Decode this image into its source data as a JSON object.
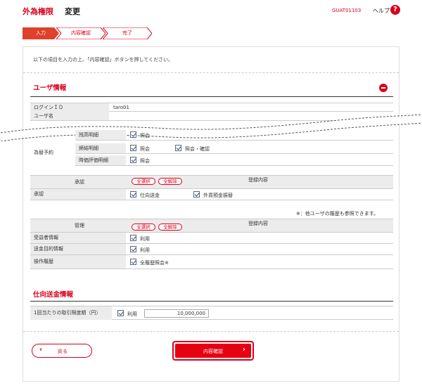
{
  "header": {
    "title_main": "外為権限",
    "title_sub": "変更",
    "screen_code": "GUAT01103",
    "help_label": "ヘルプ",
    "help_icon": "?"
  },
  "steps": [
    {
      "label": "入力",
      "active": true
    },
    {
      "label": "内容確認",
      "active": false
    },
    {
      "label": "完了",
      "active": false
    }
  ],
  "intro": "以下の項目を入力の上、「内容確認」ボタンを押してください。",
  "user_info": {
    "title": "ユーザ情報",
    "login_id_label": "ログインＩＤ",
    "login_id_value": "taro01",
    "user_name_label": "ユーザ名",
    "exchange_label": "為替予約",
    "rows": [
      {
        "label": "残高明細",
        "opt1": "照会"
      },
      {
        "label": "締結明細",
        "opt1": "照会",
        "opt2": "照会・確認"
      },
      {
        "label": "時価評価明細",
        "opt1": "照会"
      }
    ]
  },
  "approval": {
    "col1": "承認",
    "col2": "登録内容",
    "select_all": "全選択",
    "clear_all": "全解除",
    "row_label": "承認",
    "opt1": "仕向送金",
    "opt2": "外貨預金振替"
  },
  "note": "※：他ユーザの履歴も参照できます。",
  "management": {
    "col1": "管理",
    "col2": "登録内容",
    "select_all": "全選択",
    "clear_all": "全解除",
    "rows": [
      {
        "label": "受益者情報",
        "opt": "利用"
      },
      {
        "label": "送金目的情報",
        "opt": "利用"
      },
      {
        "label": "操作履歴",
        "opt": "全履歴照会※"
      }
    ]
  },
  "remittance": {
    "title": "仕向送金情報",
    "limit_label": "1回当たりの取引限度額（円）",
    "use_label": "利用",
    "amount": "10,000,000"
  },
  "buttons": {
    "back": "戻る",
    "next": "内容確認"
  },
  "colors": {
    "accent": "#d9001b"
  }
}
